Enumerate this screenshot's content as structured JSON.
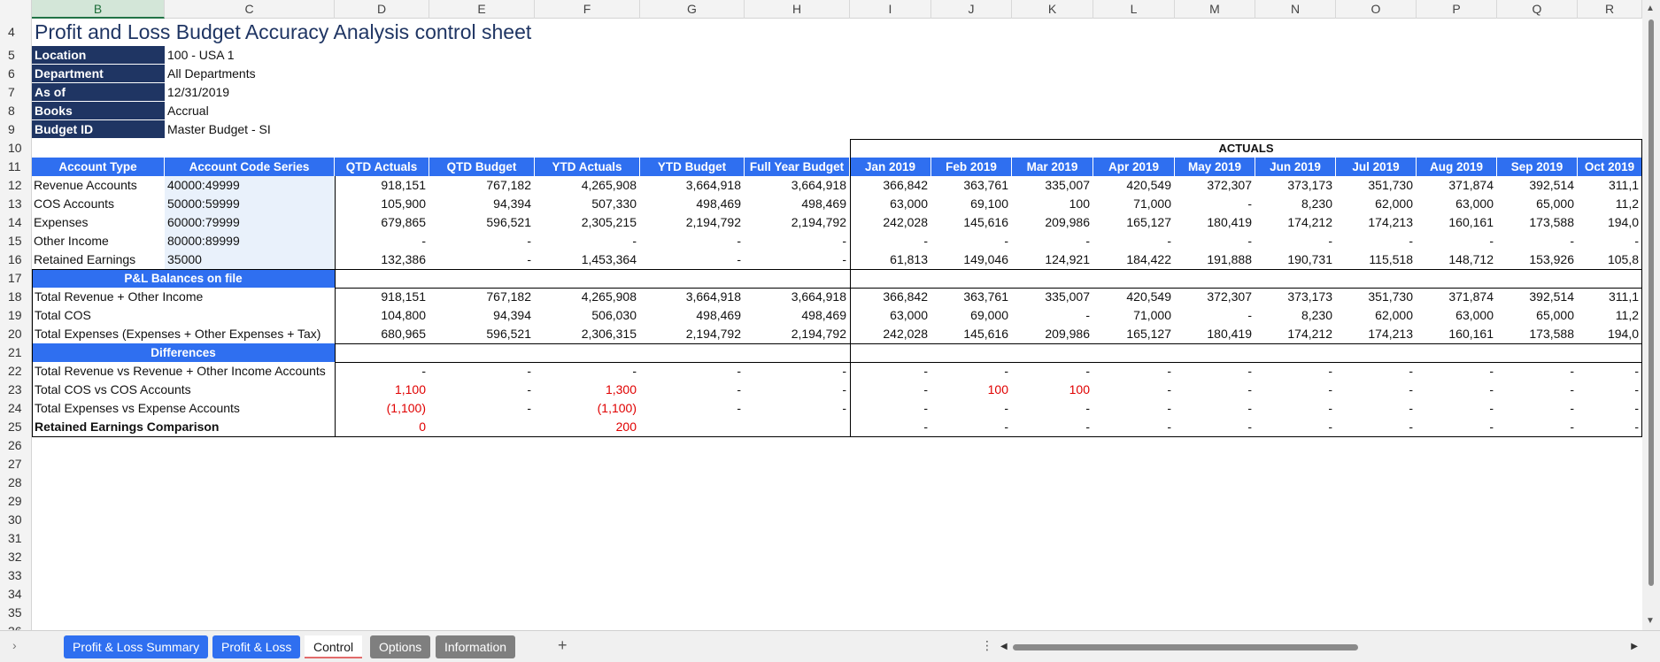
{
  "columns": [
    "B",
    "C",
    "D",
    "E",
    "F",
    "G",
    "H",
    "I",
    "J",
    "K",
    "L",
    "M",
    "N",
    "O",
    "P",
    "Q",
    "R"
  ],
  "rows": [
    "4",
    "5",
    "6",
    "7",
    "8",
    "9",
    "10",
    "11",
    "12",
    "13",
    "14",
    "15",
    "16",
    "17",
    "18",
    "19",
    "20",
    "21",
    "22",
    "23",
    "24",
    "25",
    "26",
    "27",
    "28",
    "29",
    "30",
    "31",
    "32",
    "33",
    "34",
    "35",
    "36"
  ],
  "title": "Profit and Loss Budget Accuracy Analysis control sheet",
  "params": [
    {
      "label": "Location",
      "value": "100 - USA 1"
    },
    {
      "label": "Department",
      "value": "All Departments"
    },
    {
      "label": "As of",
      "value": "12/31/2019"
    },
    {
      "label": "Books",
      "value": "Accrual"
    },
    {
      "label": "Budget ID",
      "value": "Master Budget - SI"
    }
  ],
  "actuals_label": "ACTUALS",
  "headers": [
    "Account Type",
    "Account Code Series",
    "QTD Actuals",
    "QTD Budget",
    "YTD Actuals",
    "YTD Budget",
    "Full Year Budget",
    "Jan 2019",
    "Feb 2019",
    "Mar 2019",
    "Apr 2019",
    "May 2019",
    "Jun 2019",
    "Jul 2019",
    "Aug 2019",
    "Sep 2019",
    "Oct 2019"
  ],
  "account_rows": [
    [
      "Revenue Accounts",
      "40000:49999",
      "918,151",
      "767,182",
      "4,265,908",
      "3,664,918",
      "3,664,918",
      "366,842",
      "363,761",
      "335,007",
      "420,549",
      "372,307",
      "373,173",
      "351,730",
      "371,874",
      "392,514",
      "311,1"
    ],
    [
      "COS Accounts",
      "50000:59999",
      "105,900",
      "94,394",
      "507,330",
      "498,469",
      "498,469",
      "63,000",
      "69,100",
      "100",
      "71,000",
      "-",
      "8,230",
      "62,000",
      "63,000",
      "65,000",
      "11,2"
    ],
    [
      "Expenses",
      "60000:79999",
      "679,865",
      "596,521",
      "2,305,215",
      "2,194,792",
      "2,194,792",
      "242,028",
      "145,616",
      "209,986",
      "165,127",
      "180,419",
      "174,212",
      "174,213",
      "160,161",
      "173,588",
      "194,0"
    ],
    [
      "Other Income",
      "80000:89999",
      "-",
      "-",
      "-",
      "-",
      "-",
      "-",
      "-",
      "-",
      "-",
      "-",
      "-",
      "-",
      "-",
      "-",
      "-"
    ],
    [
      "Retained Earnings",
      "35000",
      "132,386",
      "-",
      "1,453,364",
      "-",
      "-",
      "61,813",
      "149,046",
      "124,921",
      "184,422",
      "191,888",
      "190,731",
      "115,518",
      "148,712",
      "153,926",
      "105,8"
    ]
  ],
  "pl_section": "P&L Balances on file",
  "pl_rows": [
    [
      "Total Revenue + Other Income",
      "918,151",
      "767,182",
      "4,265,908",
      "3,664,918",
      "3,664,918",
      "366,842",
      "363,761",
      "335,007",
      "420,549",
      "372,307",
      "373,173",
      "351,730",
      "371,874",
      "392,514",
      "311,1"
    ],
    [
      "Total COS",
      "104,800",
      "94,394",
      "506,030",
      "498,469",
      "498,469",
      "63,000",
      "69,000",
      "-",
      "71,000",
      "-",
      "8,230",
      "62,000",
      "63,000",
      "65,000",
      "11,2"
    ],
    [
      "Total Expenses (Expenses + Other Expenses + Tax)",
      "680,965",
      "596,521",
      "2,306,315",
      "2,194,792",
      "2,194,792",
      "242,028",
      "145,616",
      "209,986",
      "165,127",
      "180,419",
      "174,212",
      "174,213",
      "160,161",
      "173,588",
      "194,0"
    ]
  ],
  "diff_section": "Differences",
  "diff_rows": [
    [
      "Total Revenue vs Revenue + Other Income Accounts",
      "-",
      "-",
      "-",
      "-",
      "-",
      "-",
      "-",
      "-",
      "-",
      "-",
      "-",
      "-",
      "-",
      "-",
      "-"
    ],
    [
      "Total COS vs COS Accounts",
      "1,100",
      "-",
      "1,300",
      "-",
      "-",
      "-",
      "100",
      "100",
      "-",
      "-",
      "-",
      "-",
      "-",
      "-",
      "-"
    ],
    [
      "Total Expenses vs Expense Accounts",
      "(1,100)",
      "-",
      "(1,100)",
      "-",
      "-",
      "-",
      "-",
      "-",
      "-",
      "-",
      "-",
      "-",
      "-",
      "-",
      "-"
    ],
    [
      "Retained Earnings Comparison",
      "0",
      "",
      "200",
      "",
      "",
      "-",
      "-",
      "-",
      "-",
      "-",
      "-",
      "-",
      "-",
      "-",
      "-"
    ]
  ],
  "tabs": [
    "Profit & Loss Summary",
    "Profit & Loss",
    "Control",
    "Options",
    "Information"
  ],
  "add_sheet": "+",
  "colors": {
    "dark_header": "#1f3563",
    "blue_header": "#2f6ff0",
    "negative": "#e00000"
  }
}
